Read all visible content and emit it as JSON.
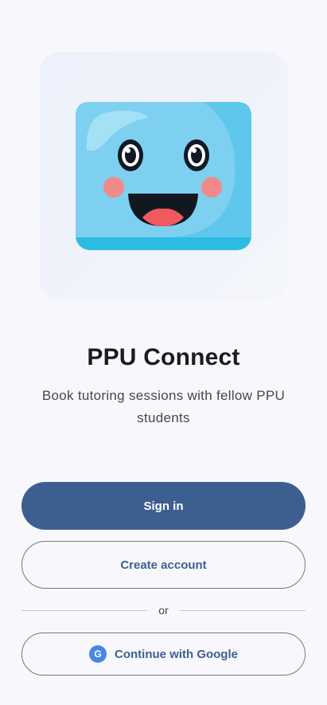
{
  "app": {
    "title": "PPU Connect",
    "subtitle": "Book tutoring sessions with fellow PPU students"
  },
  "hero": {
    "icon": "smiling-blue-mascot-icon"
  },
  "actions": {
    "sign_in_label": "Sign in",
    "create_account_label": "Create account",
    "divider_label": "or",
    "google_label": "Continue with Google",
    "google_badge": "G"
  },
  "colors": {
    "primary": "#3d5f90",
    "background": "#f8f8fc",
    "hero_card": "#eef2fb",
    "mascot_body": "#5cc5ec",
    "mascot_cheek": "#f08a8a",
    "google_badge": "#4a86e8",
    "outline": "#74777f"
  }
}
